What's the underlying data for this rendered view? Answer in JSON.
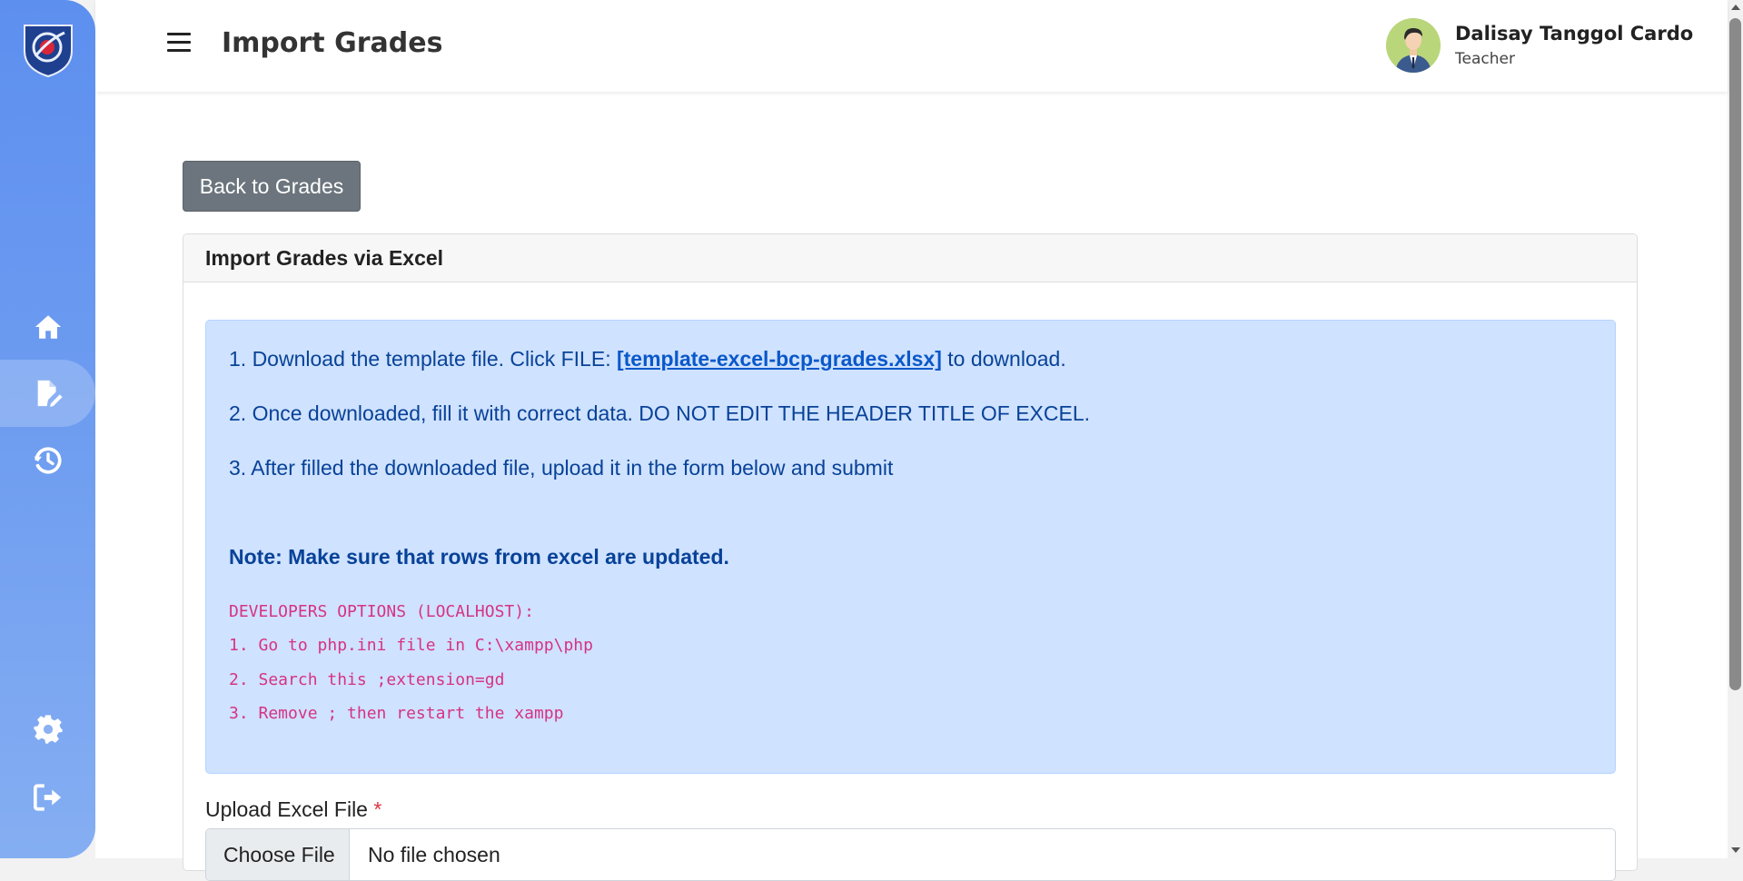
{
  "header": {
    "title": "Import Grades",
    "user_name": "Dalisay Tanggol Cardo",
    "user_role": "Teacher"
  },
  "sidebar": {
    "items": [
      {
        "icon": "home-icon"
      },
      {
        "icon": "edit-document-icon",
        "active": true
      },
      {
        "icon": "history-icon"
      },
      {
        "icon": "gear-icon"
      },
      {
        "icon": "logout-icon"
      }
    ]
  },
  "main": {
    "back_button": "Back to Grades",
    "card_title": "Import Grades via Excel",
    "steps": {
      "step1_prefix": "1. Download the template file. Click FILE: ",
      "step1_link": "[template-excel-bcp-grades.xlsx]",
      "step1_suffix": " to download.",
      "step2": "2. Once downloaded, fill it with correct data. DO NOT EDIT THE HEADER TITLE OF EXCEL.",
      "step3": "3. After filled the downloaded file, upload it in the form below and submit"
    },
    "note": "Note: Make sure that rows from excel are updated.",
    "dev_options": {
      "title": "DEVELOPERS OPTIONS (LOCALHOST):",
      "line1": "1. Go to php.ini file in C:\\xampp\\php",
      "line2": "2. Search this ;extension=gd",
      "line3": "3. Remove ; then restart the xampp"
    },
    "upload": {
      "label": "Upload Excel File",
      "required_mark": "*",
      "choose_button": "Choose File",
      "status": "No file chosen"
    }
  },
  "colors": {
    "sidebar_top": "#5d8fef",
    "alert_bg": "#cfe2ff",
    "alert_text": "#084298",
    "link": "#0a58ca",
    "dev_text": "#d63384",
    "back_button": "#6c757d"
  }
}
